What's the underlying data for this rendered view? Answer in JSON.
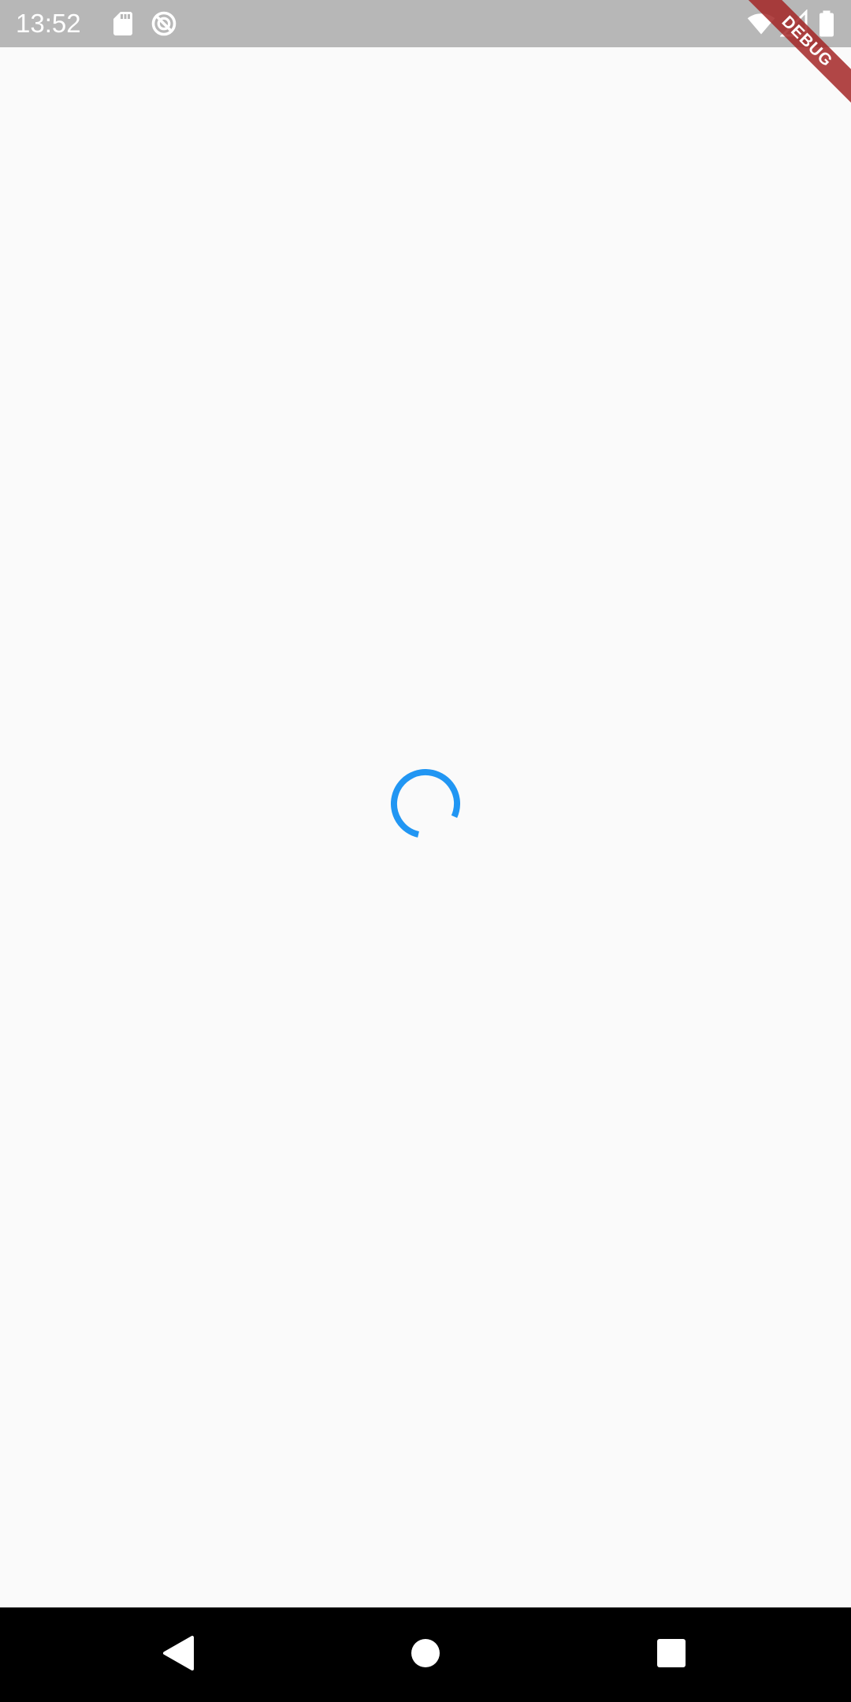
{
  "status_bar": {
    "time": "13:52",
    "icons": [
      "sd-card-icon",
      "do-not-disturb-icon",
      "wifi-icon",
      "signal-icon",
      "battery-icon"
    ],
    "background": "#b7b7b7"
  },
  "main": {
    "state": "loading",
    "spinner_color": "#2196f3",
    "background": "#fafafa"
  },
  "debug_banner": {
    "label": "DEBUG",
    "color": "#a32626"
  },
  "nav_bar": {
    "buttons": [
      "back-icon",
      "home-icon",
      "recents-icon"
    ],
    "background": "#000000"
  }
}
